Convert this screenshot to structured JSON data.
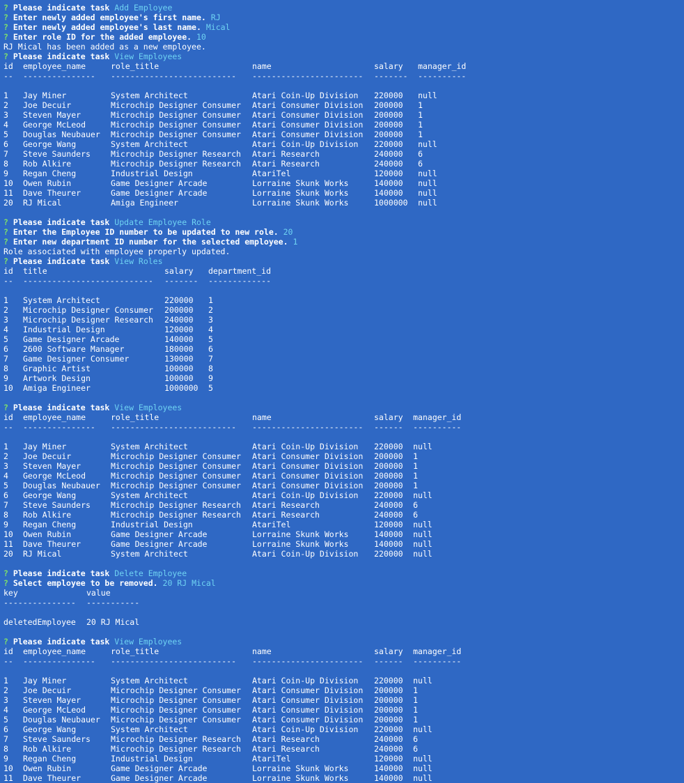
{
  "terminal": {
    "blocks": [
      {
        "type": "prompt",
        "q": "?",
        "text": "Please indicate task",
        "answer": "Add Employee"
      },
      {
        "type": "prompt",
        "q": "?",
        "text": "Enter newly added employee's first name.",
        "answer": "RJ"
      },
      {
        "type": "prompt",
        "q": "?",
        "text": "Enter newly added employee's last name.",
        "answer": "Mical"
      },
      {
        "type": "prompt",
        "q": "?",
        "text": "Enter role ID for the added employee.",
        "answer": "10"
      },
      {
        "type": "text",
        "text": "RJ Mical has been added as a new employee."
      },
      {
        "type": "prompt",
        "q": "?",
        "text": "Please indicate task",
        "answer": "View Employees"
      },
      {
        "type": "table",
        "widths": [
          28,
          126,
          203,
          175,
          63,
          80
        ],
        "headers": [
          "id",
          "employee_name",
          "role_title",
          "name",
          "salary",
          "manager_id"
        ],
        "separators": [
          "--",
          "---------------",
          "--------------------------",
          "-----------------------",
          "-------",
          "----------"
        ],
        "rows": [
          [
            "1",
            "Jay Miner",
            "System Architect",
            "Atari Coin-Up Division",
            "220000",
            "null"
          ],
          [
            "2",
            "Joe Decuir",
            "Microchip Designer Consumer",
            "Atari Consumer Division",
            "200000",
            "1"
          ],
          [
            "3",
            "Steven Mayer",
            "Microchip Designer Consumer",
            "Atari Consumer Division",
            "200000",
            "1"
          ],
          [
            "4",
            "George McLeod",
            "Microchip Designer Consumer",
            "Atari Consumer Division",
            "200000",
            "1"
          ],
          [
            "5",
            "Douglas Neubauer",
            "Microchip Designer Consumer",
            "Atari Consumer Division",
            "200000",
            "1"
          ],
          [
            "6",
            "George Wang",
            "System Architect",
            "Atari Coin-Up Division",
            "220000",
            "null"
          ],
          [
            "7",
            "Steve Saunders",
            "Microchip Designer Research",
            "Atari Research",
            "240000",
            "6"
          ],
          [
            "8",
            "Rob Alkire",
            "Microchip Designer Research",
            "Atari Research",
            "240000",
            "6"
          ],
          [
            "9",
            "Regan Cheng",
            "Industrial Design",
            "AtariTel",
            "120000",
            "null"
          ],
          [
            "10",
            "Owen Rubin",
            "Game Designer Arcade",
            "Lorraine Skunk Works",
            "140000",
            "null"
          ],
          [
            "11",
            "Dave Theurer",
            "Game Designer Arcade",
            "Lorraine Skunk Works",
            "140000",
            "null"
          ],
          [
            "20",
            "RJ Mical",
            "Amiga Engineer",
            "Lorraine Skunk Works",
            "1000000",
            "null"
          ]
        ]
      },
      {
        "type": "blank"
      },
      {
        "type": "prompt",
        "q": "?",
        "text": "Please indicate task",
        "answer": "Update Employee Role"
      },
      {
        "type": "prompt",
        "q": "?",
        "text": "Enter the Employee ID number to be updated to new role.",
        "answer": "20"
      },
      {
        "type": "prompt",
        "q": "?",
        "text": "Enter new department ID number for the selected employee.",
        "answer": "1"
      },
      {
        "type": "text",
        "text": "Role associated with employee properly updated."
      },
      {
        "type": "prompt",
        "q": "?",
        "text": "Please indicate task",
        "answer": "View Roles"
      },
      {
        "type": "table",
        "widths": [
          28,
          203,
          63,
          110
        ],
        "headers": [
          "id",
          "title",
          "salary",
          "department_id"
        ],
        "separators": [
          "--",
          "---------------------------",
          "-------",
          "-------------"
        ],
        "rows": [
          [
            "1",
            "System Architect",
            "220000",
            "1"
          ],
          [
            "2",
            "Microchip Designer Consumer",
            "200000",
            "2"
          ],
          [
            "3",
            "Microchip Designer Research",
            "240000",
            "3"
          ],
          [
            "4",
            "Industrial Design",
            "120000",
            "4"
          ],
          [
            "5",
            "Game Designer Arcade",
            "140000",
            "5"
          ],
          [
            "6",
            "2600 Software Manager",
            "180000",
            "6"
          ],
          [
            "7",
            "Game Designer Consumer",
            "130000",
            "7"
          ],
          [
            "8",
            "Graphic Artist",
            "100000",
            "8"
          ],
          [
            "9",
            "Artwork Design",
            "100000",
            "9"
          ],
          [
            "10",
            "Amiga Engineer",
            "1000000",
            "5"
          ]
        ]
      },
      {
        "type": "blank"
      },
      {
        "type": "prompt",
        "q": "?",
        "text": "Please indicate task",
        "answer": "View Employees"
      },
      {
        "type": "table",
        "widths": [
          28,
          126,
          203,
          175,
          56,
          80
        ],
        "headers": [
          "id",
          "employee_name",
          "role_title",
          "name",
          "salary",
          "manager_id"
        ],
        "separators": [
          "--",
          "---------------",
          "--------------------------",
          "-----------------------",
          "------",
          "----------"
        ],
        "rows": [
          [
            "1",
            "Jay Miner",
            "System Architect",
            "Atari Coin-Up Division",
            "220000",
            "null"
          ],
          [
            "2",
            "Joe Decuir",
            "Microchip Designer Consumer",
            "Atari Consumer Division",
            "200000",
            "1"
          ],
          [
            "3",
            "Steven Mayer",
            "Microchip Designer Consumer",
            "Atari Consumer Division",
            "200000",
            "1"
          ],
          [
            "4",
            "George McLeod",
            "Microchip Designer Consumer",
            "Atari Consumer Division",
            "200000",
            "1"
          ],
          [
            "5",
            "Douglas Neubauer",
            "Microchip Designer Consumer",
            "Atari Consumer Division",
            "200000",
            "1"
          ],
          [
            "6",
            "George Wang",
            "System Architect",
            "Atari Coin-Up Division",
            "220000",
            "null"
          ],
          [
            "7",
            "Steve Saunders",
            "Microchip Designer Research",
            "Atari Research",
            "240000",
            "6"
          ],
          [
            "8",
            "Rob Alkire",
            "Microchip Designer Research",
            "Atari Research",
            "240000",
            "6"
          ],
          [
            "9",
            "Regan Cheng",
            "Industrial Design",
            "AtariTel",
            "120000",
            "null"
          ],
          [
            "10",
            "Owen Rubin",
            "Game Designer Arcade",
            "Lorraine Skunk Works",
            "140000",
            "null"
          ],
          [
            "11",
            "Dave Theurer",
            "Game Designer Arcade",
            "Lorraine Skunk Works",
            "140000",
            "null"
          ],
          [
            "20",
            "RJ Mical",
            "System Architect",
            "Atari Coin-Up Division",
            "220000",
            "null"
          ]
        ]
      },
      {
        "type": "blank"
      },
      {
        "type": "prompt",
        "q": "?",
        "text": "Please indicate task",
        "answer": "Delete Employee"
      },
      {
        "type": "prompt",
        "q": "?",
        "text": "Select employee to be removed.",
        "answer": "20 RJ Mical"
      },
      {
        "type": "table",
        "widths": [
          119,
          100
        ],
        "headers": [
          "key",
          "value"
        ],
        "separators": [
          "---------------",
          "-----------"
        ],
        "rows": [
          [
            "deletedEmployee",
            "20 RJ Mical"
          ]
        ]
      },
      {
        "type": "blank"
      },
      {
        "type": "prompt",
        "q": "?",
        "text": "Please indicate task",
        "answer": "View Employees"
      },
      {
        "type": "table",
        "widths": [
          28,
          126,
          203,
          175,
          56,
          80
        ],
        "headers": [
          "id",
          "employee_name",
          "role_title",
          "name",
          "salary",
          "manager_id"
        ],
        "separators": [
          "--",
          "---------------",
          "--------------------------",
          "-----------------------",
          "------",
          "----------"
        ],
        "rows": [
          [
            "1",
            "Jay Miner",
            "System Architect",
            "Atari Coin-Up Division",
            "220000",
            "null"
          ],
          [
            "2",
            "Joe Decuir",
            "Microchip Designer Consumer",
            "Atari Consumer Division",
            "200000",
            "1"
          ],
          [
            "3",
            "Steven Mayer",
            "Microchip Designer Consumer",
            "Atari Consumer Division",
            "200000",
            "1"
          ],
          [
            "4",
            "George McLeod",
            "Microchip Designer Consumer",
            "Atari Consumer Division",
            "200000",
            "1"
          ],
          [
            "5",
            "Douglas Neubauer",
            "Microchip Designer Consumer",
            "Atari Consumer Division",
            "200000",
            "1"
          ],
          [
            "6",
            "George Wang",
            "System Architect",
            "Atari Coin-Up Division",
            "220000",
            "null"
          ],
          [
            "7",
            "Steve Saunders",
            "Microchip Designer Research",
            "Atari Research",
            "240000",
            "6"
          ],
          [
            "8",
            "Rob Alkire",
            "Microchip Designer Research",
            "Atari Research",
            "240000",
            "6"
          ],
          [
            "9",
            "Regan Cheng",
            "Industrial Design",
            "AtariTel",
            "120000",
            "null"
          ],
          [
            "10",
            "Owen Rubin",
            "Game Designer Arcade",
            "Lorraine Skunk Works",
            "140000",
            "null"
          ],
          [
            "11",
            "Dave Theurer",
            "Game Designer Arcade",
            "Lorraine Skunk Works",
            "140000",
            "null"
          ]
        ]
      }
    ]
  }
}
